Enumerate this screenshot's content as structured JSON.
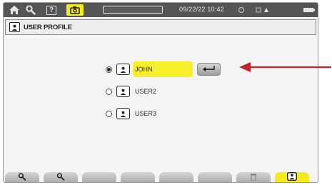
{
  "statusbar": {
    "datetime": "09/22/22 10:42",
    "icons": [
      "home-icon",
      "wrench-icon",
      "help-icon",
      "camera-icon",
      "sync-icon",
      "network-icon",
      "battery-icon"
    ],
    "active_color": "#f5ea1c"
  },
  "title": {
    "text": "USER PROFILE",
    "icon": "user-icon"
  },
  "profiles": [
    {
      "name": "JOHN",
      "selected": true
    },
    {
      "name": "USER2",
      "selected": false
    },
    {
      "name": "USER3",
      "selected": false
    }
  ],
  "enter_button": {
    "icon": "enter-icon"
  },
  "function_keys": [
    {
      "icon": "wrench-icon",
      "enabled": true
    },
    {
      "icon": "wrench-icon",
      "enabled": true
    },
    {
      "icon": "",
      "enabled": false
    },
    {
      "icon": "",
      "enabled": false
    },
    {
      "icon": "",
      "enabled": false
    },
    {
      "icon": "",
      "enabled": false
    },
    {
      "icon": "trash-icon",
      "enabled": false
    },
    {
      "icon": "user-icon",
      "enabled": true,
      "active": true
    }
  ],
  "annotation": {
    "color": "#c0242b",
    "points_to": "enter-button"
  },
  "colors": {
    "highlight": "#f7ef2a",
    "statusbar_bg": "#555555",
    "screen_bg": "#f4f4f4"
  }
}
